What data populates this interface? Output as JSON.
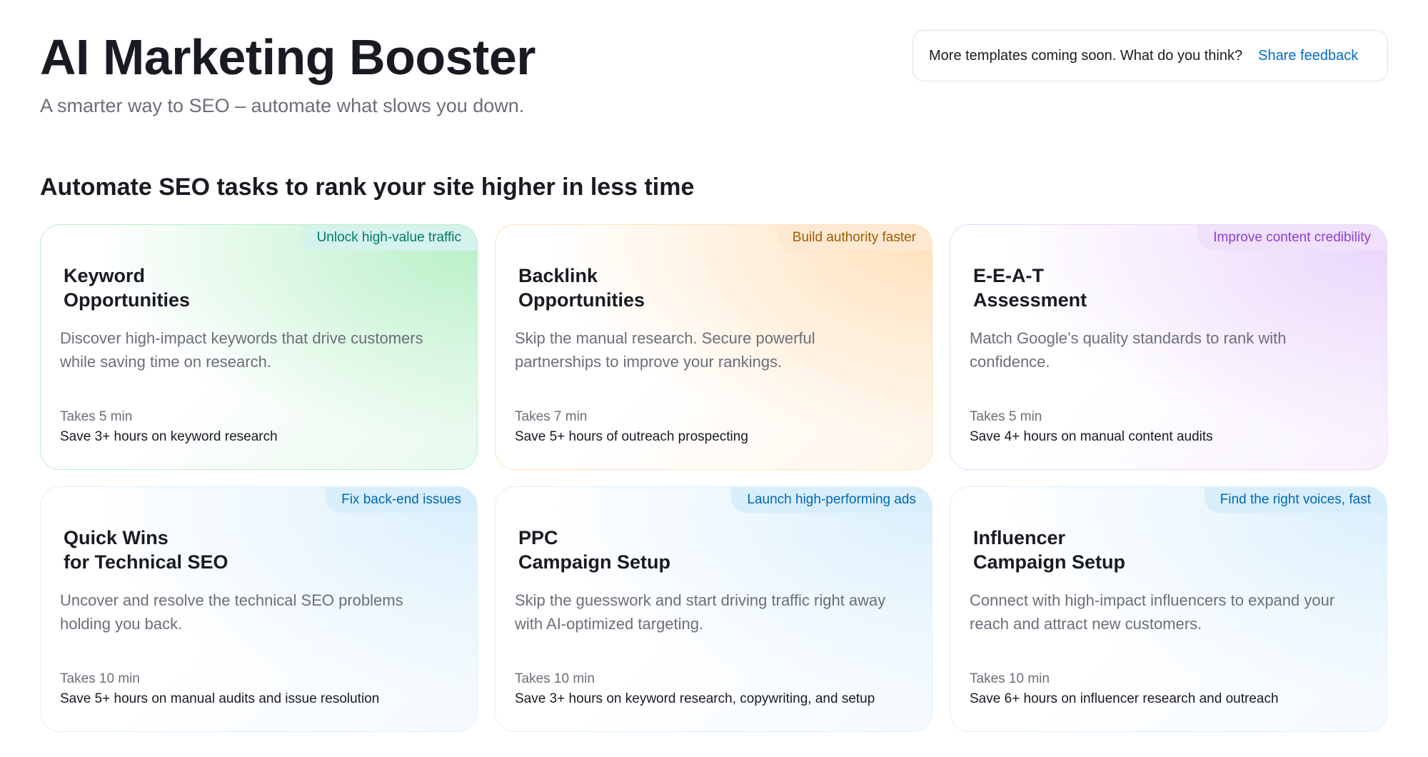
{
  "header": {
    "title": "AI Marketing Booster",
    "subtitle": "A smarter way to SEO – automate what slows you down."
  },
  "feedback": {
    "text": "More templates coming soon. What do you think?",
    "link_label": "Share feedback",
    "link_color": "#006dca"
  },
  "section": {
    "title": "Automate SEO tasks to rank your site higher in less time"
  },
  "cards": [
    {
      "tag": "Unlock high-value traffic",
      "tag_color": "#00796b",
      "tag_bg": "#d4f3ec",
      "accent": "#b9f0c8",
      "title_line1": "Keyword",
      "title_line2": "Opportunities",
      "description": "Discover high-impact keywords that drive customers while saving time on research.",
      "time": "Takes 5 min",
      "save": "Save 3+ hours on keyword research"
    },
    {
      "tag": "Build authority faster",
      "tag_color": "#a15c00",
      "tag_bg": "#fde9d2",
      "accent": "#ffe2bd",
      "title_line1": "Backlink",
      "title_line2": "Opportunities",
      "description": "Skip the manual research. Secure powerful partnerships to improve your rankings.",
      "time": "Takes 7 min",
      "save": "Save 5+ hours of outreach prospecting"
    },
    {
      "tag": "Improve content credibility",
      "tag_color": "#8d3fd0",
      "tag_bg": "#efe1fb",
      "accent": "#ead6fb",
      "title_line1": "E-E-A-T",
      "title_line2": "Assessment",
      "description": "Match Google’s quality standards to rank with confidence.",
      "time": "Takes 5 min",
      "save": "Save 4+ hours on manual content audits"
    },
    {
      "tag": "Fix back-end issues",
      "tag_color": "#0068b3",
      "tag_bg": "#d8eefb",
      "accent": "#dcf0fd",
      "title_line1": "Quick Wins",
      "title_line2": "for Technical SEO",
      "description": "Uncover and resolve the technical SEO problems holding you back.",
      "time": "Takes 10 min",
      "save": "Save 5+ hours on manual audits and issue resolution"
    },
    {
      "tag": "Launch high-performing ads",
      "tag_color": "#0068b3",
      "tag_bg": "#d8eefb",
      "accent": "#dcf0fd",
      "title_line1": "PPC",
      "title_line2": "Campaign Setup",
      "description": "Skip the guesswork and start driving traffic right away with AI-optimized targeting.",
      "time": "Takes 10 min",
      "save": "Save 3+ hours on keyword research, copywriting, and setup"
    },
    {
      "tag": "Find the right voices, fast",
      "tag_color": "#0068b3",
      "tag_bg": "#d8eefb",
      "accent": "#dcf0fd",
      "title_line1": "Influencer",
      "title_line2": "Campaign Setup",
      "description": "Connect with high-impact influencers to expand your reach and attract new customers.",
      "time": "Takes 10 min",
      "save": "Save 6+ hours on influencer research and outreach"
    }
  ]
}
